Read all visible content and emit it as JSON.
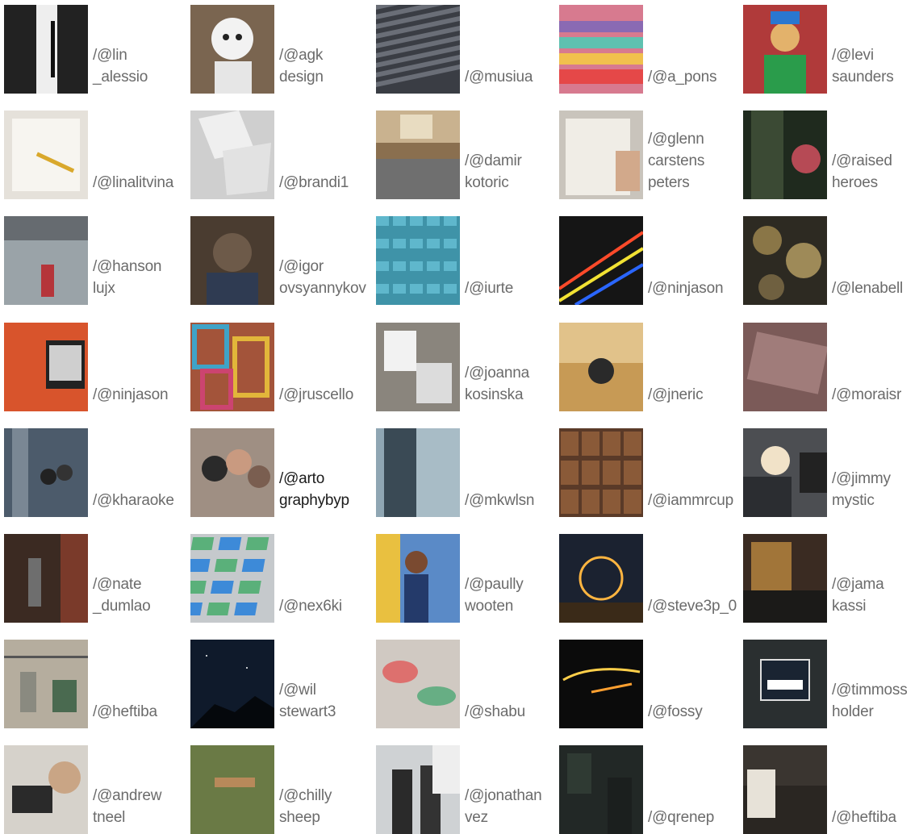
{
  "credits": [
    {
      "lines": [
        "/@lin",
        "_alessio"
      ],
      "icon": "dark-door-photo-icon",
      "dominant": "#222222"
    },
    {
      "lines": [
        "/@agk",
        "design"
      ],
      "icon": "robot-photo-icon",
      "dominant": "#7a6550"
    },
    {
      "lines": [
        "/@musiua"
      ],
      "icon": "stadium-seats-photo-icon",
      "dominant": "#3a3d44"
    },
    {
      "lines": [
        "/@a_pons"
      ],
      "icon": "paper-fan-photo-icon",
      "dominant": "#d77a8f"
    },
    {
      "lines": [
        "/@levi",
        "saunders"
      ],
      "icon": "clown-photo-icon",
      "dominant": "#b03a3a"
    },
    {
      "lines": [
        "/@linalitvina"
      ],
      "icon": "desk-pencil-photo-icon",
      "dominant": "#e5e1da"
    },
    {
      "lines": [
        "/@brandi1"
      ],
      "icon": "white-papers-photo-icon",
      "dominant": "#cfcfcf"
    },
    {
      "lines": [
        "/@damir",
        "kotoric"
      ],
      "icon": "grand-central-photo-icon",
      "dominant": "#8a6f4f"
    },
    {
      "lines": [
        "/@glenn",
        "carstens",
        "peters"
      ],
      "icon": "writing-notebook-photo-icon",
      "dominant": "#c9c4bc"
    },
    {
      "lines": [
        "/@raised",
        "heroes"
      ],
      "icon": "train-window-photo-icon",
      "dominant": "#1f2a1e"
    },
    {
      "lines": [
        "/@hanson",
        "lujx"
      ],
      "icon": "subway-station-photo-icon",
      "dominant": "#9aa3a8"
    },
    {
      "lines": [
        "/@igor",
        "ovsyannykov"
      ],
      "icon": "photographer-photo-icon",
      "dominant": "#4a3c30"
    },
    {
      "lines": [
        "/@iurte"
      ],
      "icon": "blue-lego-photo-icon",
      "dominant": "#3f93a8"
    },
    {
      "lines": [
        "/@ninjason"
      ],
      "icon": "neon-lines-photo-icon",
      "dominant": "#151515"
    },
    {
      "lines": [
        "/@lenabell"
      ],
      "icon": "globes-photo-icon",
      "dominant": "#2d2a22"
    },
    {
      "lines": [
        "/@ninjason"
      ],
      "icon": "orange-wall-window-photo-icon",
      "dominant": "#d8542c"
    },
    {
      "lines": [
        "/@jruscello"
      ],
      "icon": "colorful-frames-photo-icon",
      "dominant": "#a3543a"
    },
    {
      "lines": [
        "/@joanna",
        "kosinska"
      ],
      "icon": "old-photos-photo-icon",
      "dominant": "#8a857d"
    },
    {
      "lines": [
        "/@jneric"
      ],
      "icon": "quad-bike-photo-icon",
      "dominant": "#c79a55"
    },
    {
      "lines": [
        "/@moraisr"
      ],
      "icon": "vintage-text-photo-icon",
      "dominant": "#7b5a58"
    },
    {
      "lines": [
        "/@kharaoke"
      ],
      "icon": "city-crowd-photo-icon",
      "dominant": "#4c5b6b"
    },
    {
      "lines": [
        "/@arto",
        "graphybyp"
      ],
      "icon": "friends-group-photo-icon",
      "dominant": "#9f8f83"
    },
    {
      "lines": [
        "/@mkwlsn"
      ],
      "icon": "building-sky-photo-icon",
      "dominant": "#8fa6b3"
    },
    {
      "lines": [
        "/@iammrcup"
      ],
      "icon": "typeset-blocks-photo-icon",
      "dominant": "#5a3a28"
    },
    {
      "lines": [
        "/@jimmy",
        "mystic"
      ],
      "icon": "woman-glasses-photo-icon",
      "dominant": "#4c4e52"
    },
    {
      "lines": [
        "/@nate",
        "_dumlao"
      ],
      "icon": "coffee-pour-photo-icon",
      "dominant": "#3b2a22"
    },
    {
      "lines": [
        "/@nex6ki"
      ],
      "icon": "building-windows-photo-icon",
      "dominant": "#c5c9cc"
    },
    {
      "lines": [
        "/@paully",
        "wooten"
      ],
      "icon": "graffiti-wall-photo-icon",
      "dominant": "#5a8ac7"
    },
    {
      "lines": [
        "/@steve3p_0"
      ],
      "icon": "steel-wool-photo-icon",
      "dominant": "#1b2230"
    },
    {
      "lines": [
        "/@jama",
        "kassi"
      ],
      "icon": "neon-bar-photo-icon",
      "dominant": "#3a2b22"
    },
    {
      "lines": [
        "/@heftiba"
      ],
      "icon": "cafe-interior-photo-icon",
      "dominant": "#b5ad9e"
    },
    {
      "lines": [
        "/@wil",
        "stewart3"
      ],
      "icon": "night-sky-photo-icon",
      "dominant": "#0f1a2b"
    },
    {
      "lines": [
        "/@shabu"
      ],
      "icon": "blurred-colors-photo-icon",
      "dominant": "#d0c9c2"
    },
    {
      "lines": [
        "/@fossy"
      ],
      "icon": "neon-sign-photo-icon",
      "dominant": "#0b0b0b"
    },
    {
      "lines": [
        "/@timmoss",
        "holder"
      ],
      "icon": "closed-sign-photo-icon",
      "dominant": "#2a2f30"
    },
    {
      "lines": [
        "/@andrew",
        "tneel"
      ],
      "icon": "laptop-woman-photo-icon",
      "dominant": "#d6d2cb"
    },
    {
      "lines": [
        "/@chilly",
        "sheep"
      ],
      "icon": "cliff-legs-photo-icon",
      "dominant": "#5d6a3e"
    },
    {
      "lines": [
        "/@jonathan",
        "vez"
      ],
      "icon": "whiteboard-men-photo-icon",
      "dominant": "#cfd2d4"
    },
    {
      "lines": [
        "/@qrenep"
      ],
      "icon": "dark-street-photo-icon",
      "dominant": "#222826"
    },
    {
      "lines": [
        "/@heftiba"
      ],
      "icon": "reading-man-photo-icon",
      "dominant": "#3a3530"
    }
  ]
}
